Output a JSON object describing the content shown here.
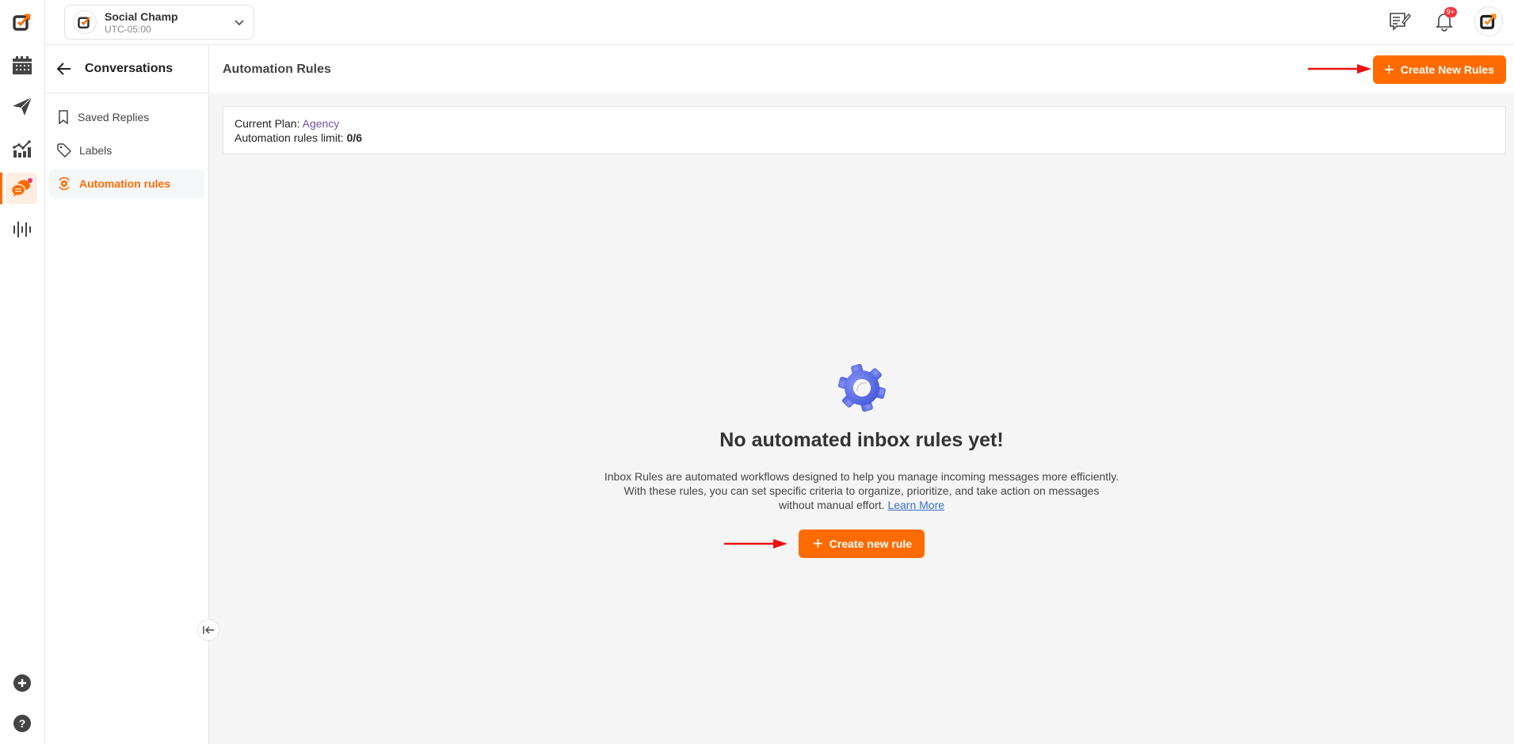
{
  "workspace": {
    "name": "Social Champ",
    "timezone": "UTC-05:00"
  },
  "notifications": {
    "badge": "9+"
  },
  "rail": {
    "items": [
      "logo",
      "calendar",
      "publish",
      "analytics",
      "conversations",
      "listening"
    ],
    "bottom": [
      "add",
      "help"
    ]
  },
  "subsidebar": {
    "title": "Conversations",
    "items": [
      {
        "label": "Saved Replies",
        "icon": "bookmark-icon"
      },
      {
        "label": "Labels",
        "icon": "tag-icon"
      },
      {
        "label": "Automation rules",
        "icon": "automation-icon",
        "active": true
      }
    ]
  },
  "page": {
    "title": "Automation Rules",
    "create_button": "Create New Rules",
    "plan_label": "Current Plan: ",
    "plan_value": "Agency",
    "limit_label": "Automation rules limit: ",
    "limit_value": "0/6"
  },
  "empty_state": {
    "title": "No automated inbox rules yet!",
    "line1": "Inbox Rules are automated workflows designed to help you manage incoming messages more efficiently.",
    "line2": "With these rules, you can set specific criteria to organize, prioritize, and take action on messages",
    "line3": "without manual effort. ",
    "link": "Learn More",
    "button": "Create new rule"
  },
  "colors": {
    "accent": "#ff6b00",
    "plan": "#7b4fa8",
    "link": "#3a6fcf",
    "gear": "#5b6ee8"
  }
}
